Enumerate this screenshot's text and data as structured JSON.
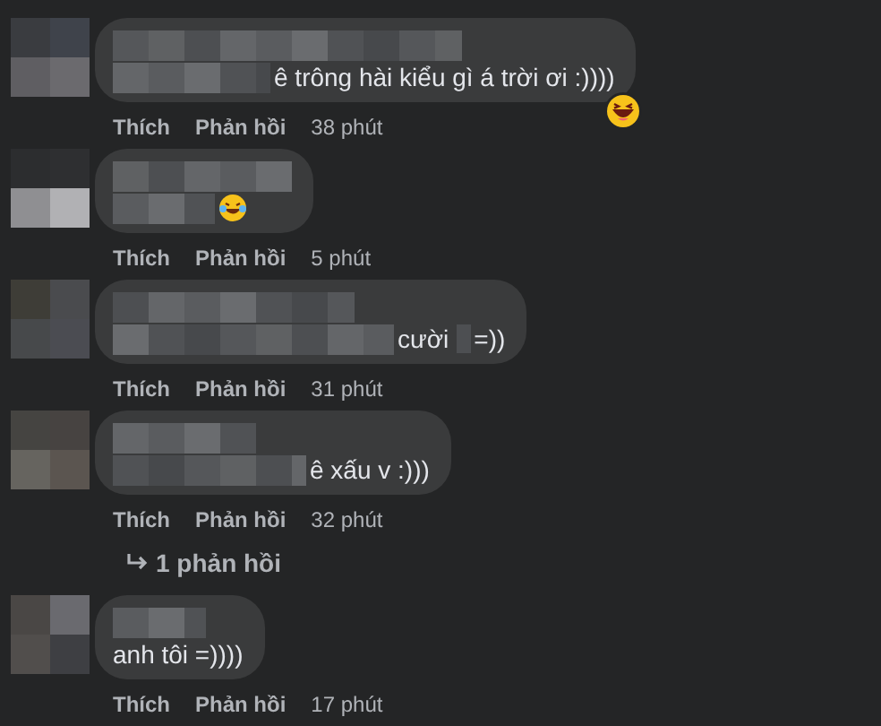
{
  "comments": [
    {
      "parts": [
        "ê trông hài kiểu gì á trời ơi :))))"
      ],
      "reacted": true,
      "actions": [
        "Thích",
        "Phản hồi"
      ],
      "time": "38 phút"
    },
    {
      "emoji_after_text": true,
      "actions": [
        "Thích",
        "Phản hồi"
      ],
      "time": "5 phút"
    },
    {
      "parts": [
        "cười",
        "=))"
      ],
      "actions": [
        "Thích",
        "Phản hồi"
      ],
      "time": "31 phút"
    },
    {
      "parts": [
        "ê xấu v :)))"
      ],
      "actions": [
        "Thích",
        "Phản hồi"
      ],
      "time": "32 phút",
      "replies_link": "1 phản hồi"
    },
    {
      "parts": [
        "anh tôi =))))"
      ],
      "actions": [
        "Thích",
        "Phản hồi"
      ],
      "time": "17 phút",
      "text_on_new_line": true
    }
  ]
}
